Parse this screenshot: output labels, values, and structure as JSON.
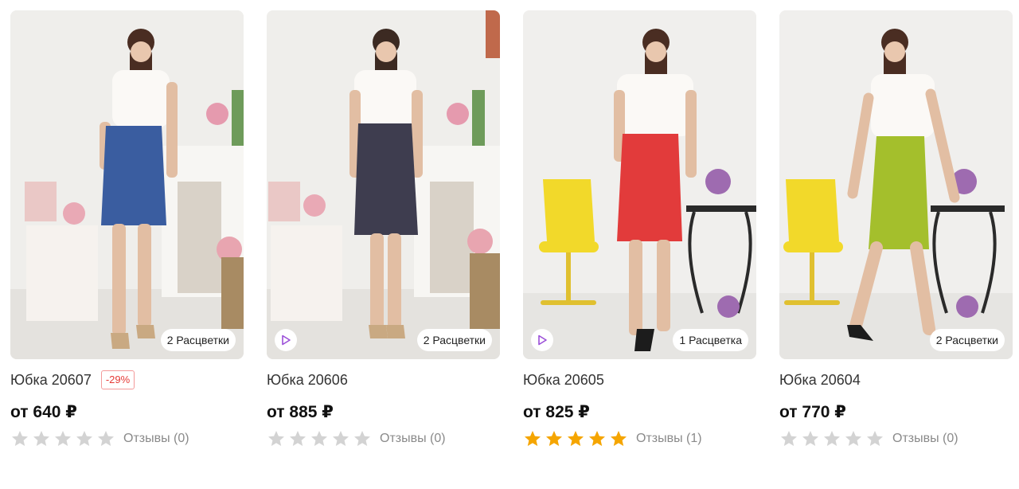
{
  "products": [
    {
      "title": "Юбка 20607",
      "discount": "-29%",
      "price": "от 640 ₽",
      "colors_badge": "2 Расцветки",
      "has_video": false,
      "rating": 0,
      "reviews": "Отзывы (0)",
      "skirt_color": "#3a5da0"
    },
    {
      "title": "Юбка 20606",
      "discount": "",
      "price": "от 885 ₽",
      "colors_badge": "2 Расцветки",
      "has_video": true,
      "rating": 0,
      "reviews": "Отзывы (0)",
      "skirt_color": "#3e3d4f"
    },
    {
      "title": "Юбка 20605",
      "discount": "",
      "price": "от 825 ₽",
      "colors_badge": "1 Расцветка",
      "has_video": true,
      "rating": 5,
      "reviews": "Отзывы (1)",
      "skirt_color": "#e23b3b"
    },
    {
      "title": "Юбка 20604",
      "discount": "",
      "price": "от 770 ₽",
      "colors_badge": "2 Расцветки",
      "has_video": false,
      "rating": 0,
      "reviews": "Отзывы (0)",
      "skirt_color": "#a4bf2c"
    }
  ],
  "colors": {
    "star_filled": "#f5a500",
    "star_empty": "#d3d3d3",
    "play_icon": "#9b4fd8",
    "discount": "#e53935"
  },
  "icons": {
    "play": "play-icon",
    "star": "star-icon"
  }
}
